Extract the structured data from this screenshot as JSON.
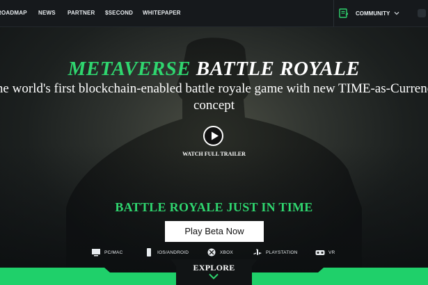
{
  "nav": {
    "links": [
      "ROADMAP",
      "NEWS",
      "PARTNER",
      "$SECOND",
      "WHITEPAPER"
    ],
    "community_label": "COMMUNITY",
    "icons": [
      "document-icon",
      "chevron-down-icon"
    ]
  },
  "hero": {
    "title_green": "METAVERSE",
    "title_white": "BATTLE ROYALE",
    "subtitle_line1": "The world's first blockchain-enabled battle royale game with new TIME-as-Currency",
    "subtitle_line2": "concept",
    "watch_label": "WATCH FULL TRAILER",
    "tagline": "BATTLE ROYALE JUST IN TIME",
    "cta_label": "Play Beta Now",
    "explore_label": "EXPLORE"
  },
  "platforms": [
    {
      "label": "PC/MAC",
      "icon": "monitor-icon"
    },
    {
      "label": "IOS/ANDROID",
      "icon": "phone-icon"
    },
    {
      "label": "XBOX",
      "icon": "xbox-icon"
    },
    {
      "label": "PLAYSTATION",
      "icon": "playstation-icon"
    },
    {
      "label": "VR",
      "icon": "vr-headset-icon"
    }
  ],
  "colors": {
    "accent_green": "#2fd66f",
    "nav_bg": "#16191c",
    "band_green": "#1fd06a"
  }
}
